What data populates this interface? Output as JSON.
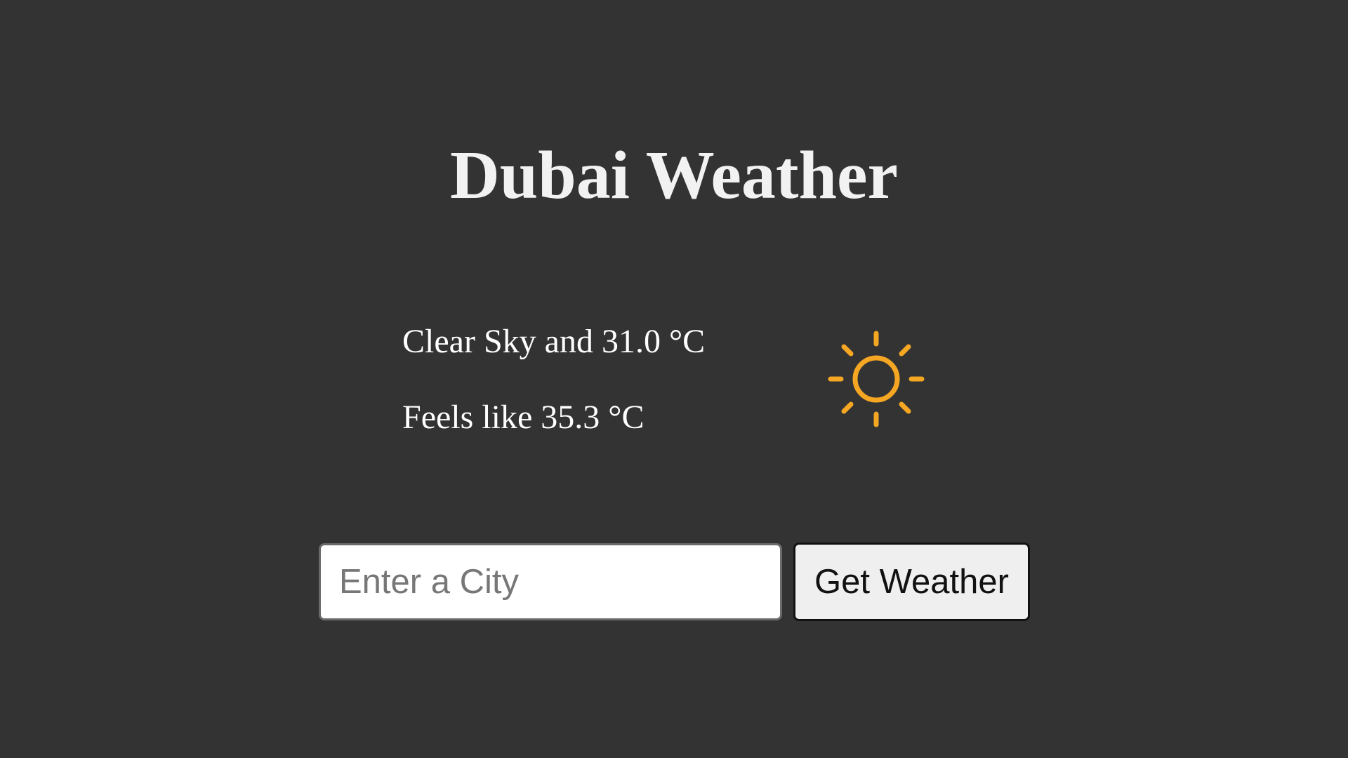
{
  "title": "Dubai Weather",
  "weather": {
    "summary": "Clear Sky and 31.0 °C",
    "feels_like": "Feels like 35.3 °C",
    "icon": "sun-icon"
  },
  "search": {
    "placeholder": "Enter a City",
    "value": "",
    "button_label": "Get Weather"
  },
  "colors": {
    "background": "#333333",
    "sun": "#f5a623",
    "text": "#ffffff"
  }
}
